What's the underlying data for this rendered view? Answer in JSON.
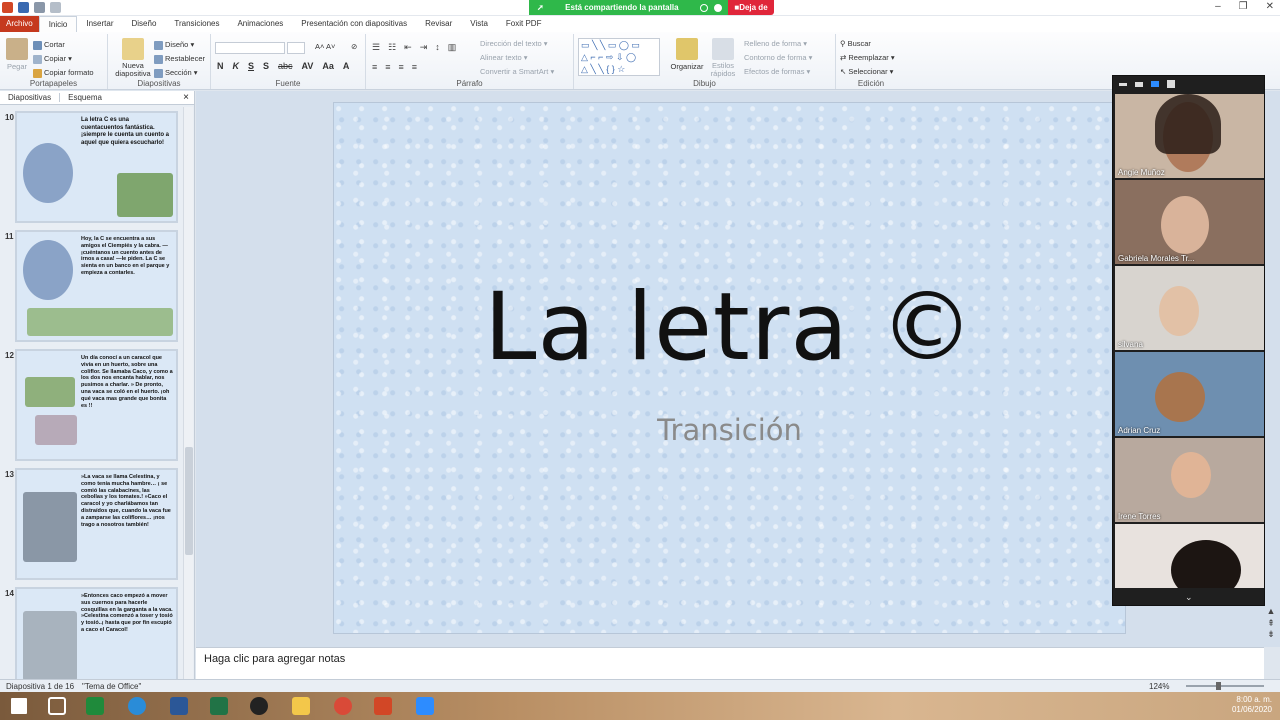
{
  "titlebar": {
    "sharing": "Está compartiendo la pantalla",
    "stop": "Deja de",
    "controls": [
      "–",
      "❐",
      "✕"
    ]
  },
  "tabs": [
    "Archivo",
    "Inicio",
    "Insertar",
    "Diseño",
    "Transiciones",
    "Animaciones",
    "Presentación con diapositivas",
    "Revisar",
    "Vista",
    "Foxit PDF"
  ],
  "ribbon": {
    "clipboard": {
      "label": "Portapapeles",
      "paste": "Pegar",
      "cut": "Cortar",
      "copy": "Copiar",
      "format": "Copiar formato"
    },
    "slides": {
      "label": "Diapositivas",
      "new": "Nueva diapositiva",
      "layout": "Diseño",
      "reset": "Restablecer",
      "section": "Sección"
    },
    "font": {
      "label": "Fuente",
      "bold": "N",
      "italic": "K",
      "underline": "S",
      "strike": "S",
      "abc": "abc"
    },
    "paragraph": {
      "label": "Párrafo",
      "direction": "Dirección del texto",
      "align": "Alinear texto",
      "smartart": "Convertir a SmartArt"
    },
    "drawing": {
      "label": "Dibujo",
      "arrange": "Organizar",
      "styles": "Estilos rápidos",
      "fill": "Relleno de forma",
      "outline": "Contorno de forma",
      "effects": "Efectos de formas"
    },
    "editing": {
      "label": "Edición",
      "find": "Buscar",
      "replace": "Reemplazar",
      "select": "Seleccionar"
    }
  },
  "leftpane": {
    "tabs": [
      "Diapositivas",
      "Esquema"
    ],
    "close": "×"
  },
  "thumbnails": [
    {
      "num": "10",
      "text": "La letra C es una cuentacuentos fantástica. ¡siempre le cuenta un cuento a aquel que quiera escucharlo!"
    },
    {
      "num": "11",
      "text": "Hoy, la C se encuentra a sus amigos el Ciempiés y la cabra. — ¡cuéntanos un cuento antes de irnos a casa! —le piden. La C se sienta en un banco en el parque y empieza a contarles."
    },
    {
      "num": "12",
      "text": "Un día conocí a un caracol que vivía en un huerto, sobre una coliflor. Se llamaba Caco, y como a los dos nos encanta hablar, nos pusimos a charlar. » De pronto, una vaca se coló en el huerto. ¡oh qué vaca mas grande que bonita es !!"
    },
    {
      "num": "13",
      "text": "»La vaca se llama Celestina, y como tenía mucha hambre… ¡ se comió las calabacines, las cebollas y los tomates.! »Caco el caracol y yo charlábamos tan distraídos que, cuando la vaca fue a zamparse las coliflores… ¡nos trago a nosotros también!"
    },
    {
      "num": "14",
      "text": "»Entonces caco empezó a mover sus cuernos para hacerle cosquillas en la garganta a la vaca. »Celestina comenzó a toser y tosió y tosió..¡ hasta que por fin escupió a caco el Caracol!"
    }
  ],
  "slide": {
    "title": "La letra  ©",
    "subtitle": "Transición"
  },
  "notes": "Haga clic para agregar notas",
  "status": {
    "slide": "Diapositiva 1 de 16",
    "theme": "\"Tema de Office\"",
    "zoom": "124%"
  },
  "clock": {
    "time": "8:00 a. m.",
    "date": "01/06/2020"
  },
  "participants": [
    "Angie Muñoz",
    "Gabriela Morales Tr...",
    "silvana",
    "Adrian Cruz",
    "Irene Torres",
    ""
  ],
  "colors": {
    "accent": "#c5391e",
    "share_green": "#2fb84a",
    "share_red": "#e0263a"
  }
}
